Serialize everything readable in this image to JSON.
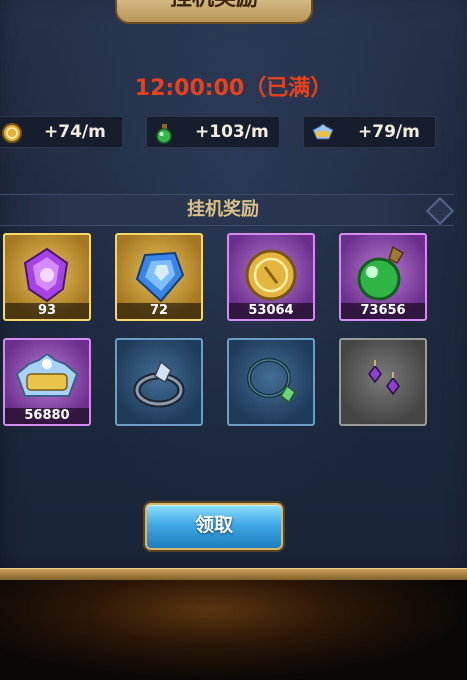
{
  "header": {
    "title": "挂机奖励"
  },
  "timer": {
    "text": "12:00:00（已满）",
    "color": "#e8421c"
  },
  "rates": [
    {
      "icon": "gold-coin-icon",
      "value": "+74/m"
    },
    {
      "icon": "green-potion-icon",
      "value": "+103/m"
    },
    {
      "icon": "exp-badge-icon",
      "value": "+79/m"
    }
  ],
  "section": {
    "title": "挂机奖励"
  },
  "rewards": [
    {
      "icon": "purple-gem-icon",
      "rarity": "gold",
      "count": "93"
    },
    {
      "icon": "blue-gem-icon",
      "rarity": "gold",
      "count": "72"
    },
    {
      "icon": "gold-coin-icon",
      "rarity": "purple",
      "count": "53064"
    },
    {
      "icon": "green-potion-icon",
      "rarity": "purple",
      "count": "73656"
    },
    {
      "icon": "exp-badge-icon",
      "rarity": "purple",
      "count": "56880"
    },
    {
      "icon": "ring-icon",
      "rarity": "blue",
      "count": ""
    },
    {
      "icon": "amulet-icon",
      "rarity": "blue",
      "count": ""
    },
    {
      "icon": "earrings-icon",
      "rarity": "grey",
      "count": ""
    }
  ],
  "actions": {
    "claim_label": "领取"
  }
}
